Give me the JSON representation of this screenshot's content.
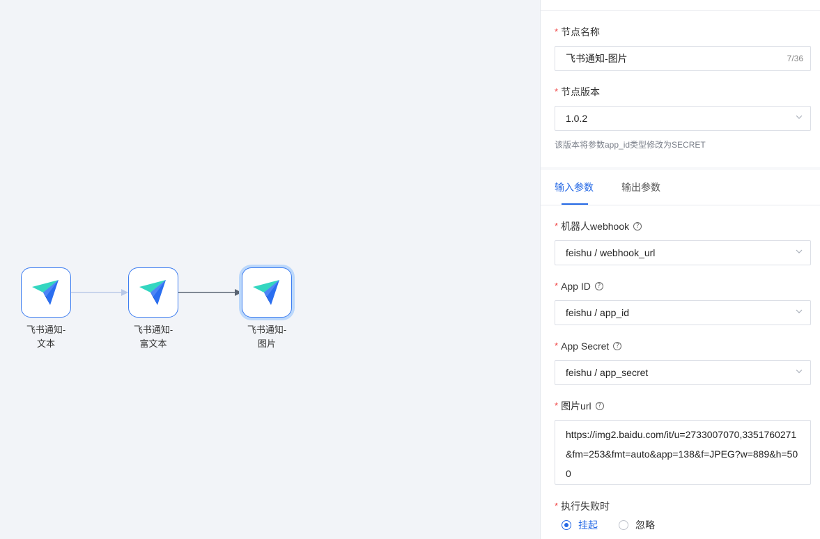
{
  "canvas": {
    "nodes": [
      {
        "line1": "飞书通知-",
        "line2": "文本",
        "selected": false
      },
      {
        "line1": "飞书通知-",
        "line2": "富文本",
        "selected": false
      },
      {
        "line1": "飞书通知-",
        "line2": "图片",
        "selected": true
      }
    ]
  },
  "panel": {
    "node_name": {
      "label": "节点名称",
      "value": "飞书通知-图片",
      "count": "7/36"
    },
    "node_version": {
      "label": "节点版本",
      "value": "1.0.2",
      "hint": "该版本将参数app_id类型修改为SECRET"
    },
    "tabs": [
      {
        "label": "输入参数",
        "active": true
      },
      {
        "label": "输出参数",
        "active": false
      }
    ],
    "params": {
      "webhook": {
        "label": "机器人webhook",
        "value": "feishu / webhook_url"
      },
      "app_id": {
        "label": "App ID",
        "value": "feishu / app_id"
      },
      "app_secret": {
        "label": "App Secret",
        "value": "feishu / app_secret"
      },
      "image_url": {
        "label": "图片url",
        "value": "https://img2.baidu.com/it/u=2733007070,3351760271&fm=253&fmt=auto&app=138&f=JPEG?w=889&h=500"
      }
    },
    "on_failure": {
      "label": "执行失败时",
      "options": [
        {
          "label": "挂起",
          "checked": true
        },
        {
          "label": "忽略",
          "checked": false
        }
      ]
    },
    "required_mark": "*",
    "help_glyph": "?"
  },
  "colors": {
    "accent": "#2468e5",
    "required": "#f04b4b",
    "canvas_bg": "#f2f4f8"
  }
}
